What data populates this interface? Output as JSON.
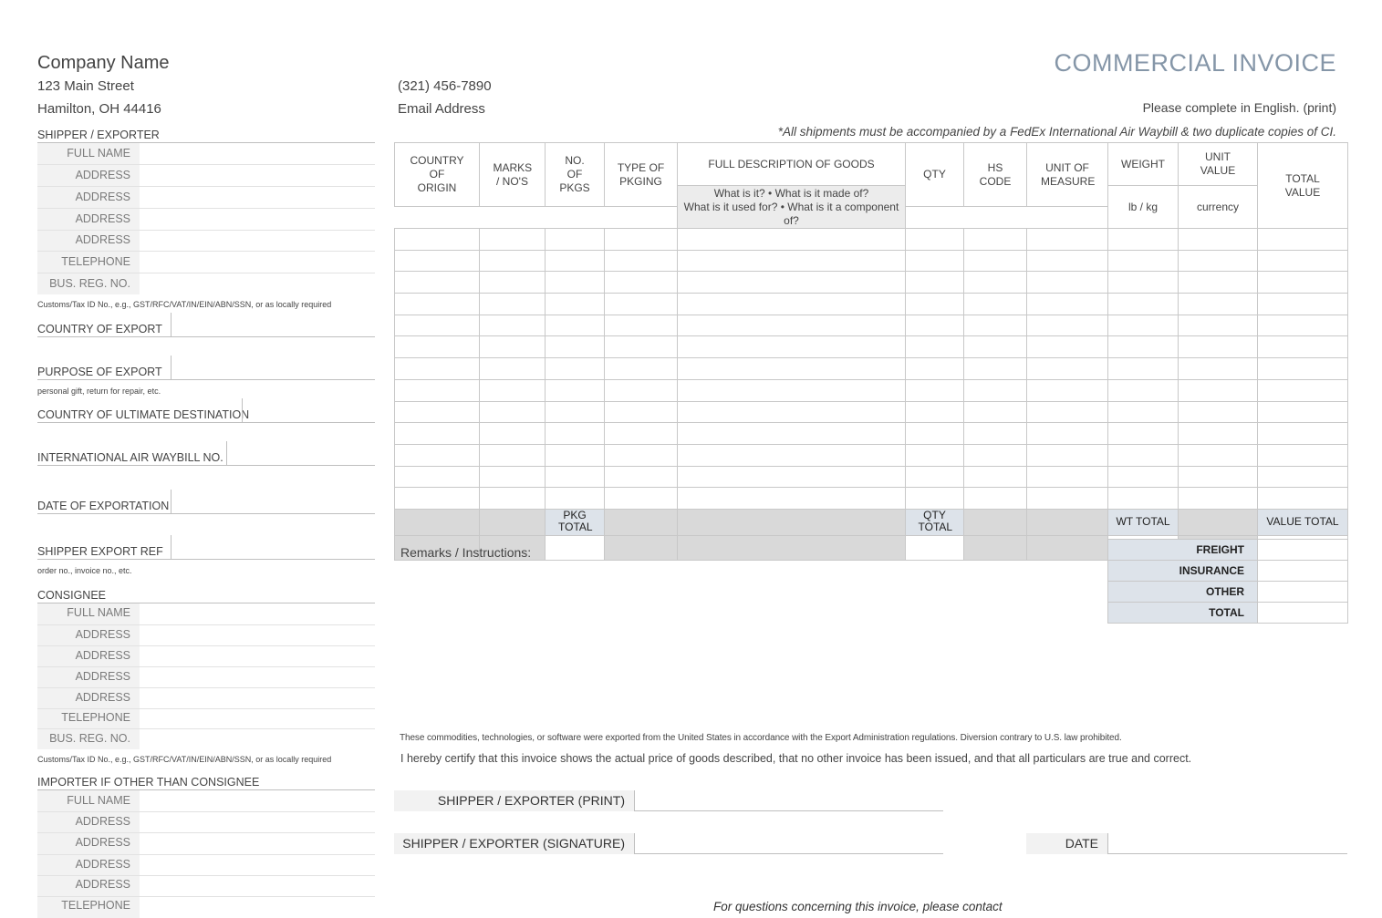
{
  "company": {
    "name": "Company Name",
    "street": "123 Main Street",
    "city": "Hamilton, OH  44416",
    "phone": "(321) 456-7890",
    "email": "Email Address"
  },
  "doc_title": "COMMERCIAL INVOICE",
  "complete_note": "Please complete in English. (print)",
  "waybill_note": "*All shipments must be accompanied by a FedEx International Air Waybill & two duplicate copies of CI.",
  "shipper": {
    "title": "SHIPPER / EXPORTER",
    "labels": [
      "FULL NAME",
      "ADDRESS",
      "ADDRESS",
      "ADDRESS",
      "ADDRESS",
      "TELEPHONE",
      "BUS. REG. NO."
    ],
    "tax_note": "Customs/Tax ID No., e.g., GST/RFC/VAT/IN/EIN/ABN/SSN, or as locally required"
  },
  "fields": {
    "country_export": "COUNTRY OF EXPORT",
    "purpose_export": "PURPOSE OF EXPORT",
    "purpose_note": "personal gift, return for repair, etc.",
    "country_dest": "COUNTRY OF ULTIMATE DESTINATION",
    "waybill_no": "INTERNATIONAL AIR WAYBILL NO.",
    "date_export": "DATE OF EXPORTATION",
    "shipper_ref": "SHIPPER EXPORT REF",
    "shipper_ref_note": "order no., invoice no., etc."
  },
  "consignee": {
    "title": "CONSIGNEE",
    "labels": [
      "FULL NAME",
      "ADDRESS",
      "ADDRESS",
      "ADDRESS",
      "ADDRESS",
      "TELEPHONE",
      "BUS. REG. NO."
    ],
    "tax_note": "Customs/Tax ID No., e.g., GST/RFC/VAT/IN/EIN/ABN/SSN, or as locally required"
  },
  "importer": {
    "title": "IMPORTER IF OTHER THAN CONSIGNEE",
    "labels": [
      "FULL NAME",
      "ADDRESS",
      "ADDRESS",
      "ADDRESS",
      "ADDRESS",
      "TELEPHONE"
    ]
  },
  "table": {
    "col_country": "COUNTRY OF ORIGIN",
    "col_marks": "MARKS / NO'S",
    "col_pkgs": "NO. OF PKGS",
    "col_type": "TYPE OF PKGING",
    "col_desc": "FULL DESCRIPTION OF GOODS",
    "desc_sub1": "What is it? • What is it made of?",
    "desc_sub2": "What is it used for? • What is it a component of?",
    "col_qty": "QTY",
    "col_hs": "HS CODE",
    "col_unit": "UNIT OF MEASURE",
    "col_weight": "WEIGHT",
    "weight_unit": "lb / kg",
    "col_unit_value": "UNIT VALUE",
    "currency": "currency",
    "col_total": "TOTAL VALUE",
    "pkg_total": "PKG TOTAL",
    "qty_total": "QTY TOTAL",
    "wt_total": "WT TOTAL",
    "value_total": "VALUE TOTAL"
  },
  "summary": {
    "freight": "FREIGHT",
    "insurance": "INSURANCE",
    "other": "OTHER",
    "total": "TOTAL"
  },
  "remarks": "Remarks / Instructions:",
  "legal_1": "These commodities, technologies, or software were exported from the United States in accordance with the Export Administration regulations. Diversion contrary to U.S. law prohibited.",
  "legal_2": "I hereby certify that this invoice shows the actual price of goods described, that no other invoice has been issued, and that all particulars are true and correct.",
  "signature": {
    "print": "SHIPPER / EXPORTER (PRINT)",
    "sign": "SHIPPER / EXPORTER (SIGNATURE)",
    "date": "DATE"
  },
  "contact_note": "For questions concerning this invoice, please contact"
}
